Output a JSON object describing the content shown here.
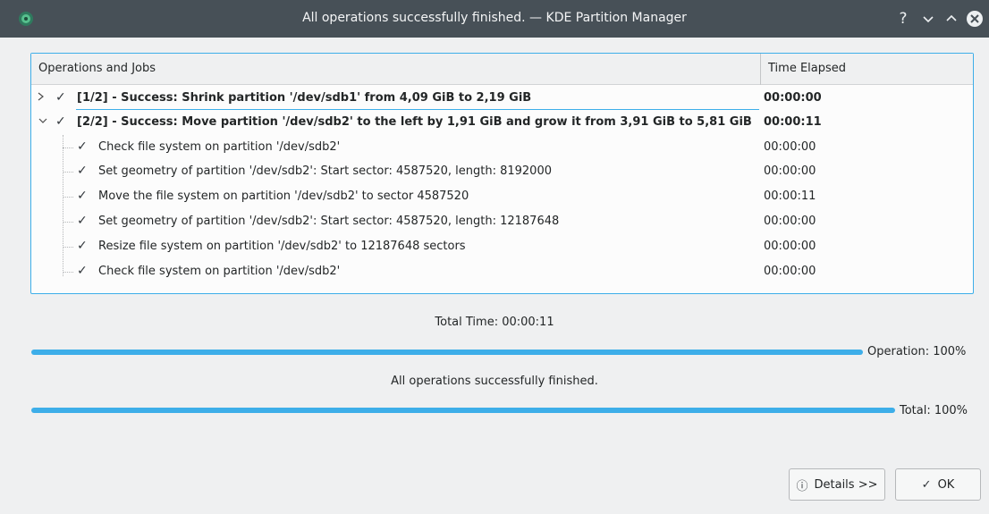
{
  "window": {
    "title": "All operations successfully finished. — KDE Partition Manager",
    "help_glyph": "?",
    "minimize_glyph": "⌄",
    "maximize_glyph": "⌃",
    "close_glyph": "✕"
  },
  "tree": {
    "columns": [
      "Operations and Jobs",
      "Time Elapsed"
    ],
    "operations": [
      {
        "label": "[1/2] - Success: Shrink partition '/dev/sdb1' from 4,09 GiB to 2,19 GiB",
        "time": "00:00:00",
        "expanded": false
      },
      {
        "label": "[2/2] - Success: Move partition '/dev/sdb2' to the left by 1,91 GiB and grow it from 3,91 GiB to 5,81 GiB",
        "time": "00:00:11",
        "expanded": true,
        "jobs": [
          {
            "label": "Check file system on partition '/dev/sdb2'",
            "time": "00:00:00"
          },
          {
            "label": "Set geometry of partition '/dev/sdb2': Start sector: 4587520, length: 8192000",
            "time": "00:00:00"
          },
          {
            "label": "Move the file system on partition '/dev/sdb2' to sector 4587520",
            "time": "00:00:11"
          },
          {
            "label": "Set geometry of partition '/dev/sdb2': Start sector: 4587520, length: 12187648",
            "time": "00:00:00"
          },
          {
            "label": "Resize file system on partition '/dev/sdb2' to 12187648 sectors",
            "time": "00:00:00"
          },
          {
            "label": "Check file system on partition '/dev/sdb2'",
            "time": "00:00:00"
          }
        ]
      }
    ],
    "check_glyph": "✓"
  },
  "progress": {
    "total_time": "Total Time: 00:00:11",
    "operation_label": "Operation: 100%",
    "operation_value": 100,
    "status": "All operations successfully finished.",
    "total_label": "Total: 100%",
    "total_value": 100
  },
  "buttons": {
    "details": "Details >>",
    "details_icon": "ⓘ",
    "ok": "OK",
    "ok_icon": "✓"
  },
  "colors": {
    "accent": "#3daee9",
    "titlebar": "#475057",
    "background": "#eff0f1"
  }
}
